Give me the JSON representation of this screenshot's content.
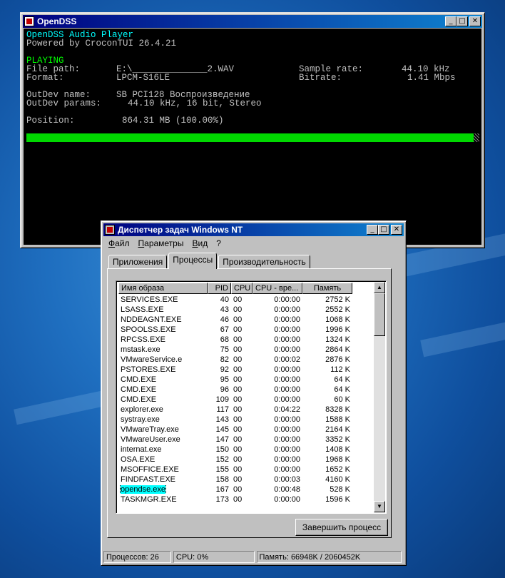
{
  "console_window": {
    "title": "OpenDSS",
    "lines": {
      "app_name": "OpenDSS Audio Player",
      "powered_by": "Powered by CroconTUI 26.4.21",
      "state": "PLAYING",
      "file_path_label": "File path:",
      "file_path_value": "E:\\______________2.WAV",
      "sample_rate_label": "Sample rate:",
      "sample_rate_value": "44.10 kHz",
      "format_label": "Format:",
      "format_value": "LPCM-S16LE",
      "bitrate_label": "Bitrate:",
      "bitrate_value": "1.41 Mbps",
      "outdev_name_label": "OutDev name:",
      "outdev_name_value": "SB PCI128 Воспроизведение",
      "outdev_params_label": "OutDev params:",
      "outdev_params_value": "44.10 kHz, 16 bit, Stereo",
      "position_label": "Position:",
      "position_value": "864.31 MB (100.00%)"
    },
    "progress_fraction": 1.0
  },
  "taskmgr": {
    "title": "Диспетчер задач Windows NT",
    "menu": [
      "Файл",
      "Параметры",
      "Вид",
      "?"
    ],
    "tabs": [
      "Приложения",
      "Процессы",
      "Производительность"
    ],
    "active_tab": "Процессы",
    "columns": [
      "Имя образа",
      "PID",
      "CPU",
      "CPU - вре...",
      "Память"
    ],
    "rows": [
      [
        "SERVICES.EXE",
        "40",
        "00",
        "0:00:00",
        "2752 K"
      ],
      [
        "LSASS.EXE",
        "43",
        "00",
        "0:00:00",
        "2552 K"
      ],
      [
        "NDDEAGNT.EXE",
        "46",
        "00",
        "0:00:00",
        "1068 K"
      ],
      [
        "SPOOLSS.EXE",
        "67",
        "00",
        "0:00:00",
        "1996 K"
      ],
      [
        "RPCSS.EXE",
        "68",
        "00",
        "0:00:00",
        "1324 K"
      ],
      [
        "mstask.exe",
        "75",
        "00",
        "0:00:00",
        "2864 K"
      ],
      [
        "VMwareService.e",
        "82",
        "00",
        "0:00:02",
        "2876 K"
      ],
      [
        "PSTORES.EXE",
        "92",
        "00",
        "0:00:00",
        "112 K"
      ],
      [
        "CMD.EXE",
        "95",
        "00",
        "0:00:00",
        "64 K"
      ],
      [
        "CMD.EXE",
        "96",
        "00",
        "0:00:00",
        "64 K"
      ],
      [
        "CMD.EXE",
        "109",
        "00",
        "0:00:00",
        "60 K"
      ],
      [
        "explorer.exe",
        "117",
        "00",
        "0:04:22",
        "8328 K"
      ],
      [
        "systray.exe",
        "143",
        "00",
        "0:00:00",
        "1588 K"
      ],
      [
        "VMwareTray.exe",
        "145",
        "00",
        "0:00:00",
        "2164 K"
      ],
      [
        "VMwareUser.exe",
        "147",
        "00",
        "0:00:00",
        "3352 K"
      ],
      [
        "internat.exe",
        "150",
        "00",
        "0:00:00",
        "1408 K"
      ],
      [
        "OSA.EXE",
        "152",
        "00",
        "0:00:00",
        "1968 K"
      ],
      [
        "MSOFFICE.EXE",
        "155",
        "00",
        "0:00:00",
        "1652 K"
      ],
      [
        "FINDFAST.EXE",
        "158",
        "00",
        "0:00:03",
        "4160 K"
      ],
      [
        "opendse.exe",
        "167",
        "00",
        "0:00:48",
        "528 K"
      ],
      [
        "TASKMGR.EXE",
        "173",
        "00",
        "0:00:00",
        "1596 K"
      ]
    ],
    "selected_row": "opendse.exe",
    "end_process_button": "Завершить процесс",
    "status": {
      "processes": "Процессов: 26",
      "cpu": "CPU: 0%",
      "memory": "Память: 66948K / 2060452K"
    }
  }
}
